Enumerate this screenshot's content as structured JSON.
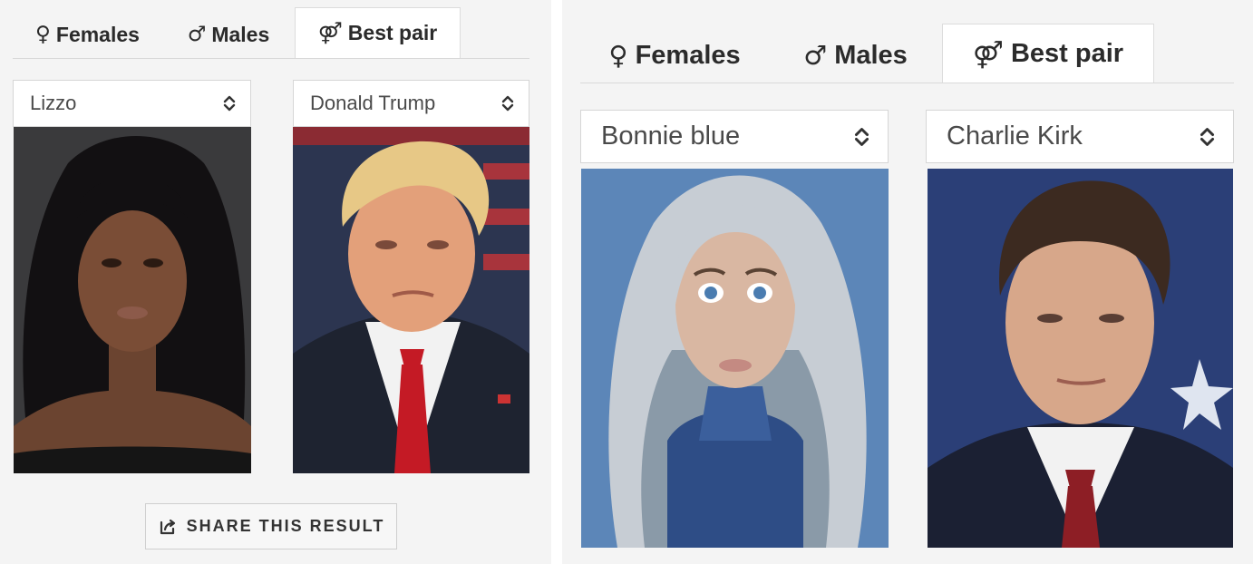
{
  "left": {
    "tabs": [
      {
        "symbol": "♀",
        "label": "Females"
      },
      {
        "symbol": "♂",
        "label": "Males"
      },
      {
        "symbol": "⚤",
        "label": "Best pair"
      }
    ],
    "female_select": {
      "value": "Lizzo"
    },
    "male_select": {
      "value": "Donald Trump"
    },
    "share_label": "SHARE THIS RESULT"
  },
  "right": {
    "tabs": [
      {
        "symbol": "♀",
        "label": "Females"
      },
      {
        "symbol": "♂",
        "label": "Males"
      },
      {
        "symbol": "⚤",
        "label": "Best pair"
      }
    ],
    "female_select": {
      "value": "Bonnie blue"
    },
    "male_select": {
      "value": "Charlie Kirk"
    }
  },
  "active_tab": "Best pair",
  "icons": {
    "select_arrows": "chevron-up-down-icon",
    "share": "share-icon"
  },
  "colors": {
    "background": "#f4f4f4",
    "tab_active": "#ffffff",
    "text": "#2b2b2b"
  }
}
